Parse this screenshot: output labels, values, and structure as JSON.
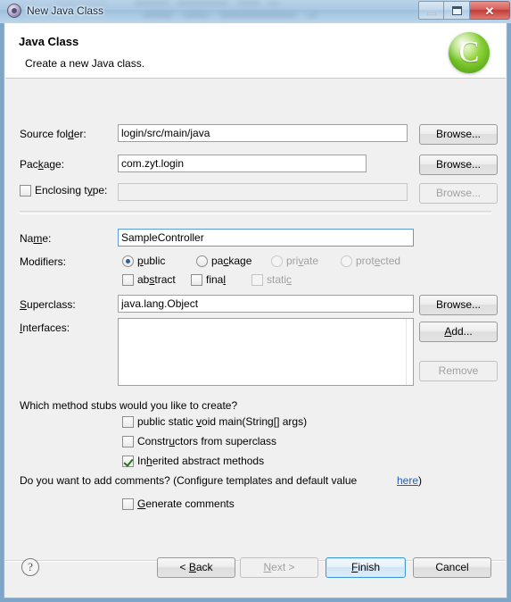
{
  "window": {
    "title": "New Java Class",
    "app_icon": "java-class-icon",
    "controls": {
      "minimize": "minimize-icon",
      "restore": "restore-icon",
      "close": "✕"
    }
  },
  "header": {
    "title": "Java Class",
    "subtitle": "Create a new Java class.",
    "icon": "green-c-badge-icon",
    "icon_glyph": "C"
  },
  "form": {
    "source_folder": {
      "label_pre": "Source fol",
      "label_mnemonic": "d",
      "label_post": "er:",
      "value": "login/src/main/java",
      "browse": "Browse..."
    },
    "package": {
      "label_pre": "Pac",
      "label_mnemonic": "k",
      "label_post": "age:",
      "value": "com.zyt.login",
      "browse": "Browse..."
    },
    "enclosing_type": {
      "label_pre": "Enclosing t",
      "label_mnemonic": "y",
      "label_post": "pe:",
      "value": "",
      "checked": false,
      "browse": "Browse..."
    },
    "name": {
      "label_pre": "Na",
      "label_mnemonic": "m",
      "label_post": "e:",
      "value": "SampleController"
    },
    "modifiers": {
      "label": "Modifiers:",
      "radios": [
        {
          "pre": "",
          "mnemonic": "p",
          "post": "ublic",
          "checked": true,
          "enabled": true
        },
        {
          "pre": "pa",
          "mnemonic": "c",
          "post": "kage",
          "checked": false,
          "enabled": true
        },
        {
          "pre": "pri",
          "mnemonic": "v",
          "post": "ate",
          "checked": false,
          "enabled": false
        },
        {
          "pre": "prot",
          "mnemonic": "e",
          "post": "cted",
          "checked": false,
          "enabled": false
        }
      ],
      "checkboxes": [
        {
          "pre": "ab",
          "mnemonic": "s",
          "post": "tract",
          "checked": false,
          "enabled": true
        },
        {
          "pre": "fina",
          "mnemonic": "l",
          "post": "",
          "checked": false,
          "enabled": true
        },
        {
          "pre": "stati",
          "mnemonic": "c",
          "post": "",
          "checked": false,
          "enabled": false
        }
      ]
    },
    "superclass": {
      "label_pre": "",
      "label_mnemonic": "S",
      "label_post": "uperclass:",
      "value": "java.lang.Object",
      "browse": "Browse..."
    },
    "interfaces": {
      "label_pre": "",
      "label_mnemonic": "I",
      "label_post": "nterfaces:",
      "items": [],
      "add": "Add...",
      "remove": "Remove"
    }
  },
  "stubs": {
    "question": "Which method stubs would you like to create?",
    "options": [
      {
        "pre": "public static ",
        "mnemonic": "v",
        "post": "oid main(String[] args)",
        "checked": false
      },
      {
        "pre": "Constr",
        "mnemonic": "u",
        "post": "ctors from superclass",
        "checked": false
      },
      {
        "pre": "In",
        "mnemonic": "h",
        "post": "erited abstract methods",
        "checked": true
      }
    ]
  },
  "comments": {
    "question_pre": "Do you want to add comments? (Configure templates and default value ",
    "link": "here",
    "question_post": ")",
    "checkbox": {
      "pre": "",
      "mnemonic": "G",
      "post": "enerate comments",
      "checked": false
    }
  },
  "footer": {
    "help": "?",
    "buttons": [
      {
        "pre": "< ",
        "mnemonic": "B",
        "post": "ack",
        "enabled": true,
        "default": false
      },
      {
        "pre": "",
        "mnemonic": "N",
        "post": "ext >",
        "enabled": false,
        "default": false
      },
      {
        "pre": "",
        "mnemonic": "F",
        "post": "inish",
        "enabled": true,
        "default": true
      },
      {
        "pre": "Cancel",
        "mnemonic": "",
        "post": "",
        "enabled": true,
        "default": false
      }
    ]
  },
  "colors": {
    "accent": "#3c99d4",
    "link": "#2a5db0",
    "titlebar": "#a9c8e2",
    "close": "#c23c36",
    "badge_green": "#86cf33"
  }
}
